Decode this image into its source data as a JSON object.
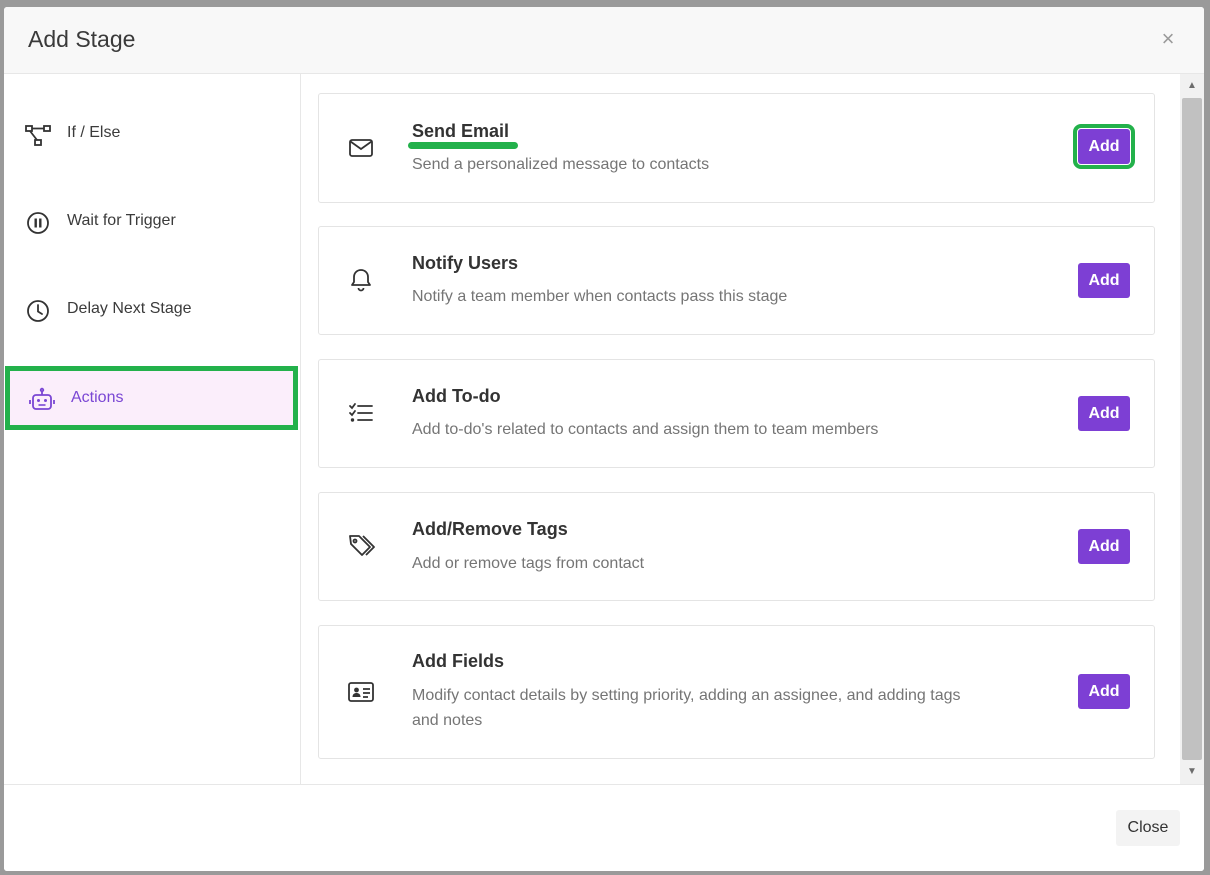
{
  "modal": {
    "title": "Add Stage",
    "close_icon": "×",
    "close_button": "Close"
  },
  "sidebar": {
    "items": [
      {
        "label": "If / Else",
        "icon": "branch-icon"
      },
      {
        "label": "Wait for Trigger",
        "icon": "pause-circle-icon"
      },
      {
        "label": "Delay Next Stage",
        "icon": "clock-icon"
      },
      {
        "label": "Actions",
        "icon": "robot-icon",
        "active": true
      }
    ]
  },
  "actions": [
    {
      "title": "Send Email",
      "description": "Send a personalized message to contacts",
      "button": "Add",
      "icon": "envelope-icon"
    },
    {
      "title": "Notify Users",
      "description": "Notify a team member when contacts pass this stage",
      "button": "Add",
      "icon": "bell-icon"
    },
    {
      "title": "Add To-do",
      "description": "Add to-do's related to contacts and assign them to team members",
      "button": "Add",
      "icon": "checklist-icon"
    },
    {
      "title": "Add/Remove Tags",
      "description": "Add or remove tags from contact",
      "button": "Add",
      "icon": "tags-icon"
    },
    {
      "title": "Add Fields",
      "description": "Modify contact details by setting priority, adding an assignee, and adding tags and notes",
      "button": "Add",
      "icon": "id-card-icon"
    }
  ],
  "colors": {
    "accent": "#7d3fd4",
    "highlight": "#23b14b",
    "active_bg": "#fbeefb"
  }
}
